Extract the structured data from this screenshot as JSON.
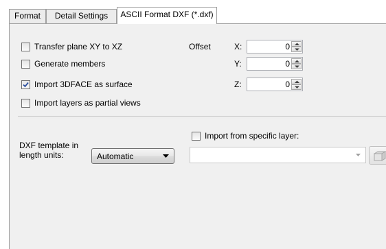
{
  "tabs": [
    {
      "label": "Format"
    },
    {
      "label": "Detail Settings"
    },
    {
      "label": "ASCII Format DXF (*.dxf)"
    }
  ],
  "options": {
    "transfer_plane": {
      "label": "Transfer plane XY to XZ",
      "checked": false
    },
    "generate_members": {
      "label": "Generate members",
      "checked": false
    },
    "import_3dface": {
      "label": "Import 3DFACE as surface",
      "checked": true
    },
    "import_layers": {
      "label": "Import layers as partial views",
      "checked": false
    }
  },
  "offset": {
    "label": "Offset",
    "x": {
      "label": "X:",
      "value": "0"
    },
    "y": {
      "label": "Y:",
      "value": "0"
    },
    "z": {
      "label": "Z:",
      "value": "0"
    }
  },
  "template": {
    "label_line1": "DXF template in",
    "label_line2": "length units:",
    "selected": "Automatic"
  },
  "specific_layer": {
    "label": "Import from specific layer:",
    "checked": false,
    "value": ""
  },
  "icons": {
    "checkmark": "checkmark-icon",
    "spin_up": "triangle-up-icon",
    "spin_down": "triangle-down-icon",
    "dropdown": "chevron-down-icon",
    "layer_button": "layer-icon"
  },
  "colors": {
    "panel_background": "#f0f0f0",
    "check_blue": "#2c4f9e"
  }
}
